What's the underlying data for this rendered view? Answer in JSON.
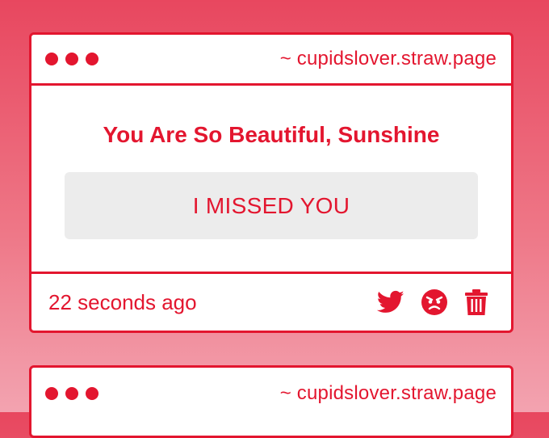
{
  "posts": [
    {
      "site": "~ cupidslover.straw.page",
      "title": "You Are So Beautiful, Sunshine",
      "message": "I MISSED YOU",
      "time": "22 seconds ago",
      "icons": [
        "twitter-icon",
        "angry-face-icon",
        "trash-icon"
      ]
    },
    {
      "site": "~ cupidslover.straw.page"
    }
  ],
  "colors": {
    "accent": "#e3162f",
    "message_bg": "#ececec",
    "background_top": "#e8475f",
    "background_bottom": "#f3a3b0"
  }
}
